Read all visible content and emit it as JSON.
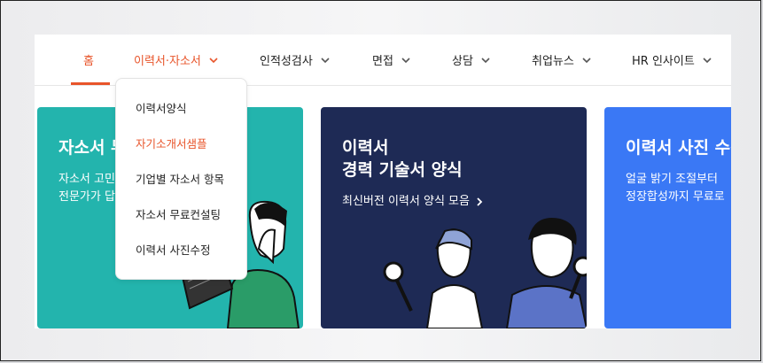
{
  "nav": {
    "items": [
      {
        "label": "홈",
        "has_chevron": false,
        "active": true
      },
      {
        "label": "이력서·자소서",
        "has_chevron": true,
        "open": true
      },
      {
        "label": "인적성검사",
        "has_chevron": true
      },
      {
        "label": "면접",
        "has_chevron": true
      },
      {
        "label": "상담",
        "has_chevron": true
      },
      {
        "label": "취업뉴스",
        "has_chevron": true
      },
      {
        "label": "HR 인사이트",
        "has_chevron": true
      }
    ]
  },
  "dropdown": {
    "items": [
      {
        "label": "이력서양식"
      },
      {
        "label": "자기소개서샘플",
        "highlighted": true
      },
      {
        "label": "기업별 자소서 항목"
      },
      {
        "label": "자소서 무료컨설팅"
      },
      {
        "label": "이력서 사진수정"
      }
    ]
  },
  "cards": [
    {
      "title": "자소서 무",
      "sub_line1": "자소서 고민",
      "sub_line2": "전문가가 답",
      "color": "#23b4ad"
    },
    {
      "title_line1": "이력서",
      "title_line2": "경력 기술서 양식",
      "sub": "최신버전 이력서 양식 모음",
      "color": "#1e2a55"
    },
    {
      "title": "이력서 사진 수정",
      "sub_line1": "얼굴 밝기 조절부터",
      "sub_line2": "정장합성까지 무료로",
      "color": "#3a78f5"
    }
  ],
  "colors": {
    "accent": "#e8542a",
    "teal": "#23b4ad",
    "navy": "#1e2a55",
    "blue": "#3a78f5"
  },
  "icons": {
    "chevron": "chevron-down-icon",
    "arrow": "chevron-right-icon"
  }
}
